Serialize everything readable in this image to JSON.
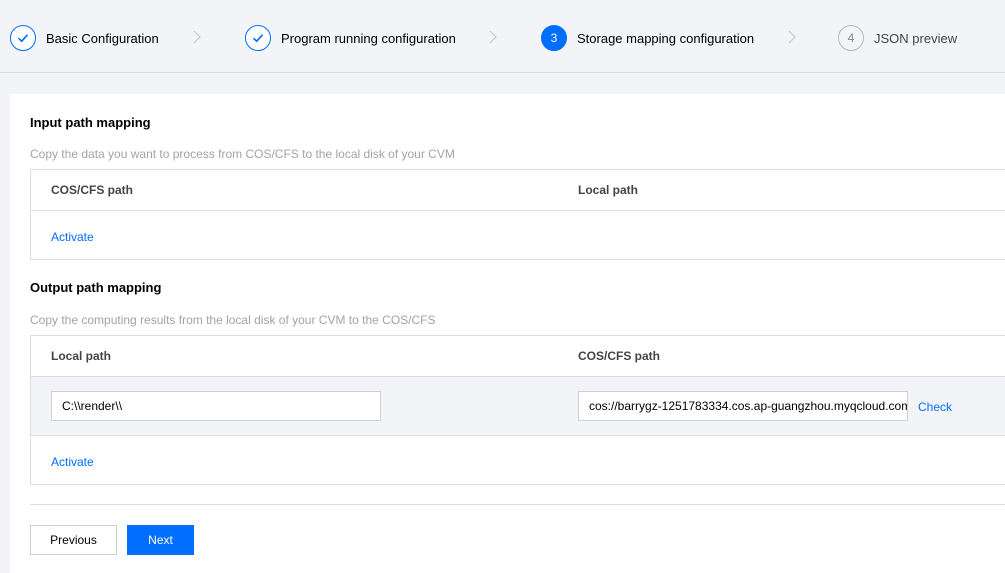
{
  "steps": [
    {
      "label": "Basic Configuration",
      "state": "done"
    },
    {
      "label": "Program running configuration",
      "state": "done"
    },
    {
      "label": "Storage mapping configuration",
      "state": "active",
      "number": "3"
    },
    {
      "label": "JSON preview",
      "state": "todo",
      "number": "4"
    }
  ],
  "input_mapping": {
    "title": "Input path mapping",
    "description": "Copy the data you want to process from COS/CFS to the local disk of your CVM",
    "columns": [
      "COS/CFS path",
      "Local path"
    ],
    "activate_label": "Activate"
  },
  "output_mapping": {
    "title": "Output path mapping",
    "description": "Copy the computing results from the local disk of your CVM to the COS/CFS",
    "columns": [
      "Local path",
      "COS/CFS path"
    ],
    "row": {
      "local_path": "C:\\\\render\\\\",
      "cos_path": "cos://barrygz-1251783334.cos.ap-guangzhou.myqcloud.com",
      "check_label": "Check"
    },
    "activate_label": "Activate"
  },
  "buttons": {
    "previous": "Previous",
    "next": "Next"
  },
  "colors": {
    "accent": "#006eff",
    "background": "#f3f4f7",
    "muted_text": "#a3a3a3",
    "border": "#dcdde0"
  }
}
